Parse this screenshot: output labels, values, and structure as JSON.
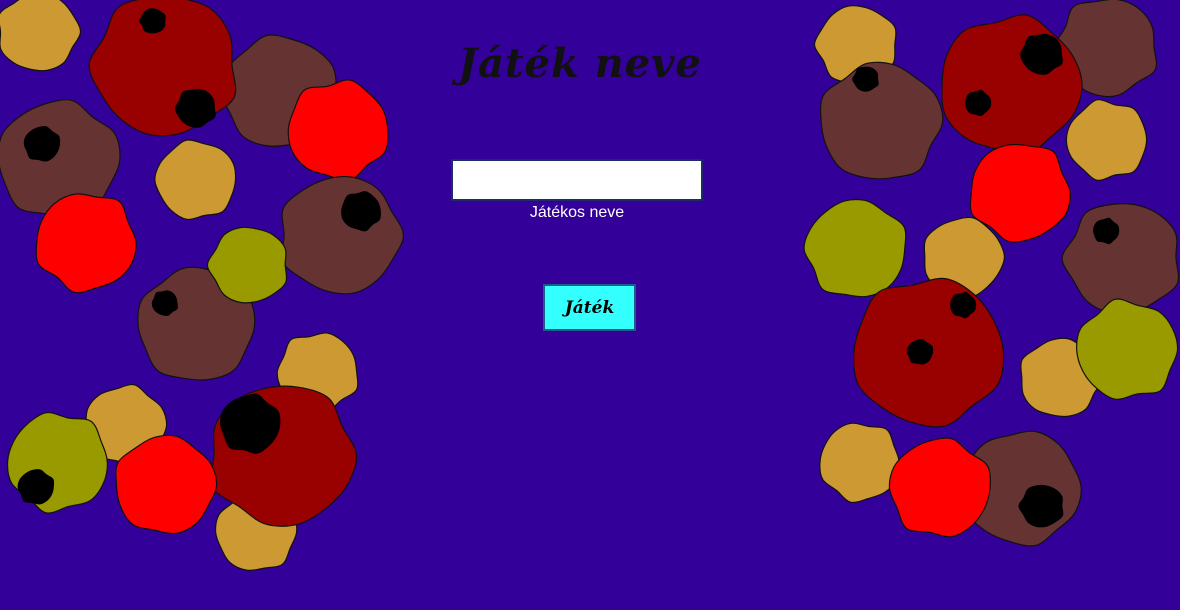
{
  "title": "Játék neve",
  "form": {
    "name_value": "",
    "name_label": "Játékos neve"
  },
  "play_button_label": "Játék",
  "colors": {
    "background": "#330099",
    "button": "#33ffff",
    "decor_palette": [
      "#cc9933",
      "#990000",
      "#663333",
      "#ff0000",
      "#999900",
      "#000000"
    ]
  }
}
